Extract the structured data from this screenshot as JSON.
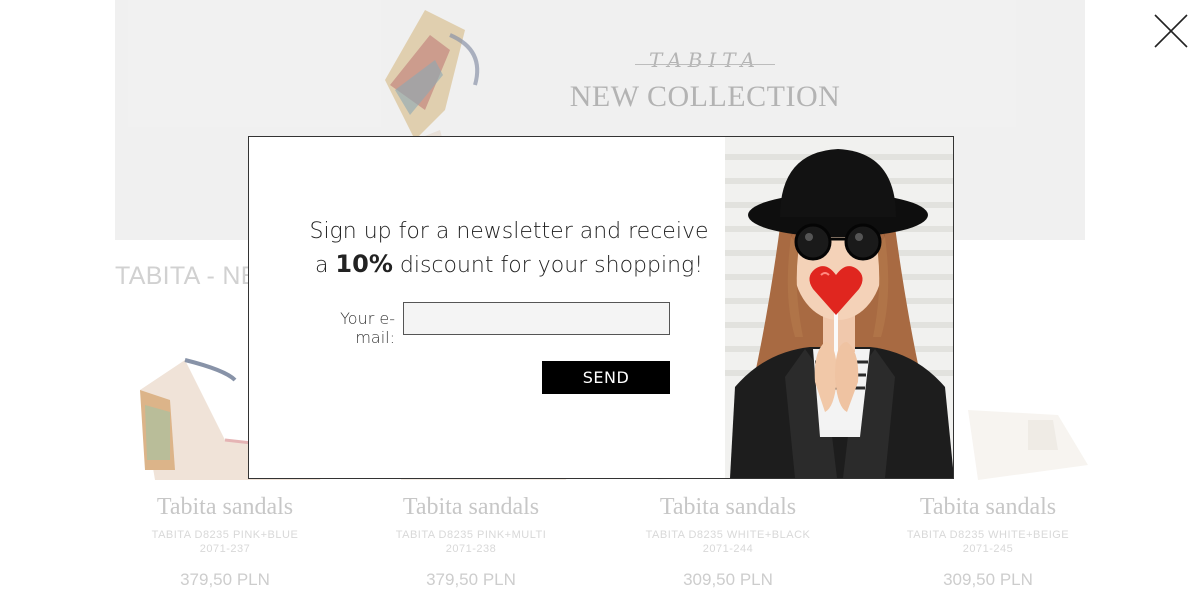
{
  "hero": {
    "brand": "TABITA",
    "title": "NEW COLLECTION"
  },
  "section": {
    "heading": "TABITA - NEW COLLECTION"
  },
  "products": [
    {
      "name": "Tabita sandals",
      "sku": "TABITA D8235 PINK+BLUE",
      "code": "2071-237",
      "price": "379,50 PLN"
    },
    {
      "name": "Tabita sandals",
      "sku": "TABITA D8235 PINK+MULTI",
      "code": "2071-238",
      "price": "379,50 PLN"
    },
    {
      "name": "Tabita sandals",
      "sku": "TABITA D8235 WHITE+BLACK",
      "code": "2071-244",
      "price": "309,50 PLN"
    },
    {
      "name": "Tabita sandals",
      "sku": "TABITA D8235 WHITE+BEIGE",
      "code": "2071-245",
      "price": "309,50 PLN"
    }
  ],
  "modal": {
    "headline_line1": "Sign up for a newsletter and receive",
    "headline_pre": "a",
    "headline_strong": "10%",
    "headline_post": "discount for your shopping!",
    "email_label": "Your e-mail:",
    "email_value": "",
    "email_placeholder": "",
    "send_label": "SEND",
    "photo_description_icon": "woman-with-heart-lollipop-image"
  },
  "icons": {
    "close": "close-icon"
  },
  "colors": {
    "send_button_bg": "#000000",
    "modal_border": "#333333",
    "hero_bg": "#e9e9e9"
  }
}
